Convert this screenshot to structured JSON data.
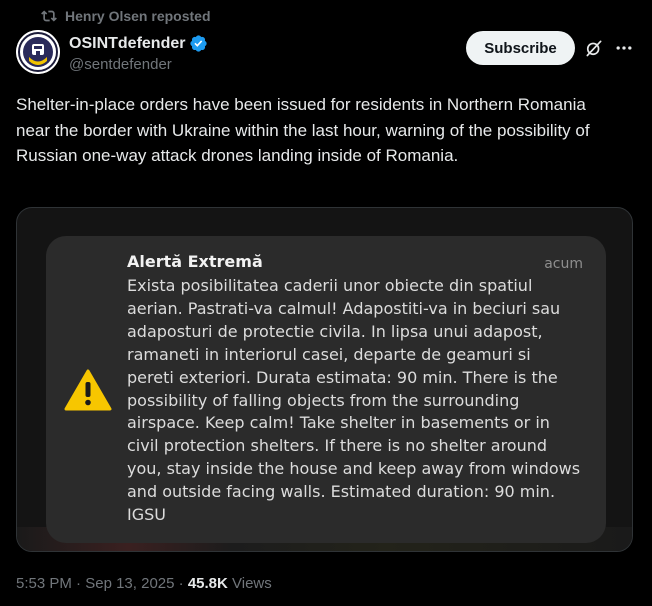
{
  "repost": {
    "icon": "repost-icon",
    "text": "Henry Olsen reposted"
  },
  "author": {
    "name": "OSINTdefender",
    "handle": "@sentdefender",
    "verified_icon": "verified-badge-icon",
    "verified_color": "#1d9bf0"
  },
  "header_actions": {
    "subscribe_label": "Subscribe",
    "grok_icon": "grok-icon",
    "more_icon": "more-icon"
  },
  "tweet": {
    "text": "Shelter-in-place orders have been issued for residents in Northern Romania near the border with Ukraine within the last hour, warning of the possibility of Russian one-way attack drones landing inside of Romania."
  },
  "media": {
    "notification": {
      "icon": "warning-triangle-icon",
      "icon_color": "#f7c600",
      "title": "Alertă Extremă",
      "time": "acum",
      "body": "Exista posibilitatea caderii unor obiecte din spatiul aerian. Pastrati-va calmul! Adapostiti-va in beciuri sau adaposturi de protectie civila. In lipsa unui adapost, ramaneti in interiorul casei, departe de geamuri si pereti exteriori. Durata estimata: 90 min. There is the possibility of falling objects from the surrounding airspace. Keep calm! Take shelter in basements or in civil protection shelters. If there is no shelter around you, stay inside the house and keep away from windows and outside facing walls. Estimated duration: 90 min. IGSU"
    }
  },
  "meta": {
    "time": "5:53 PM",
    "separator": " · ",
    "date": "Sep 13, 2025",
    "separator2": " · ",
    "views_count": "45.8K",
    "views_label": " Views"
  },
  "colors": {
    "background": "#000000",
    "text_primary": "#e7e9ea",
    "text_secondary": "#71767b",
    "accent": "#1d9bf0"
  }
}
